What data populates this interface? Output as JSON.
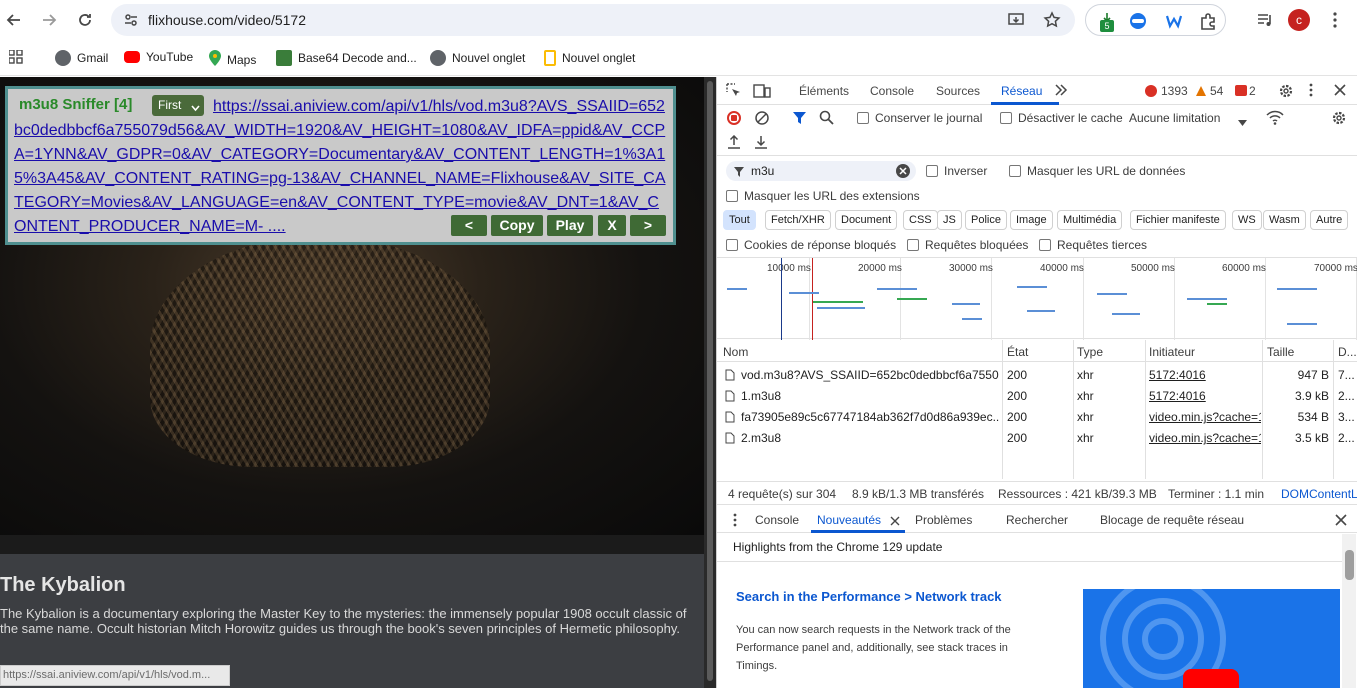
{
  "browser": {
    "url": "flixhouse.com/video/5172",
    "extension_badge": "5",
    "profile_initial": "c"
  },
  "bookmarks": [
    {
      "label": "Gmail",
      "icon": "gmail-icon"
    },
    {
      "label": "YouTube",
      "icon": "youtube-icon"
    },
    {
      "label": "Maps",
      "icon": "maps-icon"
    },
    {
      "label": "Base64 Decode and...",
      "icon": "base64-icon"
    },
    {
      "label": "Nouvel onglet",
      "icon": "globe-icon"
    },
    {
      "label": "Nouvel onglet",
      "icon": "bookmark-icon"
    }
  ],
  "sniffer": {
    "title": "m3u8 Sniffer [4]",
    "select": "First",
    "link": "https://ssai.aniview.com/api/v1/hls/vod.m3u8?AVS_SSAIID=652bc0dedbbcf6a755079d56&AV_WIDTH=1920&AV_HEIGHT=1080&AV_IDFA=ppid&AV_CCPA=1YNN&AV_GDPR=0&AV_CATEGORY=Documentary&AV_CONTENT_LENGTH=1%3A15%3A45&AV_CONTENT_RATING=pg-13&AV_CHANNEL_NAME=Flixhouse&AV_SITE_CATEGORY=Movies&AV_LANGUAGE=en&AV_CONTENT_TYPE=movie&AV_DNT=1&AV_CONTENT_PRODUCER_NAME=M- ....",
    "buttons": {
      "prev": "<",
      "copy": "Copy",
      "play": "Play",
      "close": "X",
      "next": ">"
    }
  },
  "video": {
    "title": "The Kybalion",
    "description": "The Kybalion is a documentary exploring the Master Key to the mysteries: the immensely popular 1908 occult classic of the same name. Occult historian Mitch Horowitz guides us through the book's seven principles of Hermetic philosophy."
  },
  "status_url": "https://ssai.aniview.com/api/v1/hls/vod.m...",
  "devtools": {
    "tabs": [
      "Éléments",
      "Console",
      "Sources",
      "Réseau"
    ],
    "active_tab": "Réseau",
    "errors": "1393",
    "warnings": "54",
    "issues": "2",
    "toolbar": {
      "preserve_log": "Conserver le journal",
      "disable_cache": "Désactiver le cache",
      "throttling": "Aucune limitation"
    },
    "filter": {
      "value": "m3u",
      "invert": "Inverser",
      "hide_data_urls": "Masquer les URL de données",
      "hide_ext_urls": "Masquer les URL des extensions"
    },
    "type_filters": [
      "Tout",
      "Fetch/XHR",
      "Document",
      "CSS",
      "JS",
      "Police",
      "Image",
      "Multimédia",
      "Fichier manifeste",
      "WS",
      "Wasm",
      "Autre"
    ],
    "checkboxes": [
      "Cookies de réponse bloqués",
      "Requêtes bloquées",
      "Requêtes tierces"
    ],
    "timeline_labels": [
      "10000 ms",
      "20000 ms",
      "30000 ms",
      "40000 ms",
      "50000 ms",
      "60000 ms",
      "70000 ms"
    ],
    "columns": [
      "Nom",
      "État",
      "Type",
      "Initiateur",
      "Taille",
      "D..."
    ],
    "rows": [
      {
        "name": "vod.m3u8?AVS_SSAIID=652bc0dedbbcf6a7550...",
        "status": "200",
        "type": "xhr",
        "initiator": "5172:4016",
        "size": "947 B",
        "time": "7..."
      },
      {
        "name": "1.m3u8",
        "status": "200",
        "type": "xhr",
        "initiator": "5172:4016",
        "size": "3.9 kB",
        "time": "2..."
      },
      {
        "name": "fa73905e89c5c67747184ab362f7d0d86a939ec...",
        "status": "200",
        "type": "xhr",
        "initiator": "video.min.js?cache=1",
        "size": "534 B",
        "time": "3..."
      },
      {
        "name": "2.m3u8",
        "status": "200",
        "type": "xhr",
        "initiator": "video.min.js?cache=1",
        "size": "3.5 kB",
        "time": "2..."
      }
    ],
    "summary": {
      "requests": "4 requête(s) sur 304",
      "transferred": "8.9 kB/1.3 MB transférés",
      "resources": "Ressources : 421 kB/39.3 MB",
      "finish": "Terminer : 1.1 min",
      "dom": "DOMContentL"
    },
    "drawer_tabs": [
      "Console",
      "Nouveautés",
      "Problèmes",
      "Rechercher",
      "Blocage de requête réseau"
    ],
    "whats_new": {
      "highlights": "Highlights from the Chrome 129 update",
      "heading": "Search in the Performance > Network track",
      "body": "You can now search requests in the Network track of the Performance panel and, additionally, see stack traces in Timings."
    }
  }
}
